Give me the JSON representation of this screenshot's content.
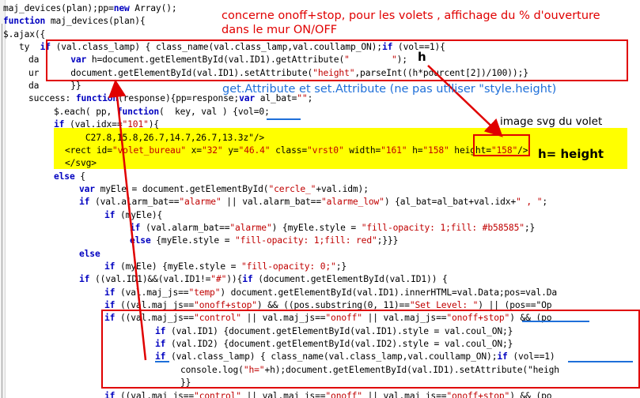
{
  "code_lines": [
    {
      "indent": 4,
      "text": "maj_devices(plan);pp=new Array();"
    },
    {
      "indent": 4,
      "text": "function maj_devices(plan){"
    },
    {
      "indent": 4,
      "text": "$.ajax({"
    },
    {
      "indent": 24,
      "text": "ty  if (val.class_lamp) { class_name(val.class_lamp,val.coullamp_ON);if (vol==1){"
    },
    {
      "indent": 36,
      "text": "da      var h=document.getElementById(val.ID1).getAttribute(\"        \");"
    },
    {
      "indent": 36,
      "text": "ur      document.getElementById(val.ID1).setAttribute(\"height\",parseInt((h*pourcent[2])/100));}"
    },
    {
      "indent": 36,
      "text": "da      }}"
    },
    {
      "indent": 36,
      "text": "success: function(response){pp=response;var al_bat=\"\";"
    },
    {
      "indent": 68,
      "text": "$.each( pp, function(  key, val ) {vol=0;"
    },
    {
      "indent": 68,
      "text": "if (val.idx==\"101\"){"
    },
    {
      "indent": 68,
      "text": "      C27.8,15.8,26.7,14.7,26.7,13.3z\"/>"
    },
    {
      "indent": 82,
      "text": "<rect id=\"volet_bureau\" x=\"32\" y=\"46.4\" class=\"vrst0\" width=\"161\" h=\"158\" height=\"158\"/>"
    },
    {
      "indent": 82,
      "text": "</svg>"
    },
    {
      "indent": 68,
      "text": "else {"
    },
    {
      "indent": 100,
      "text": "var myEle = document.getElementById(\"cercle_\"+val.idm);"
    },
    {
      "indent": 100,
      "text": "if (val.alarm_bat==\"alarme\" || val.alarm_bat==\"alarme_low\") {al_bat=al_bat+val.idx+\" , \";"
    },
    {
      "indent": 132,
      "text": "if (myEle){"
    },
    {
      "indent": 164,
      "text": "if (val.alarm_bat==\"alarme\") {myEle.style = \"fill-opacity: 1;fill: #b58585\";}"
    },
    {
      "indent": 164,
      "text": "else {myEle.style = \"fill-opacity: 1;fill: red\";}}}"
    },
    {
      "indent": 100,
      "text": "else"
    },
    {
      "indent": 132,
      "text": "if (myEle) {myEle.style = \"fill-opacity: 0;\";}"
    },
    {
      "indent": 100,
      "text": "if ((val.ID1)&&(val.ID1!=\"#\")){if (document.getElementById(val.ID1)) {"
    },
    {
      "indent": 132,
      "text": "if (val.maj_js==\"temp\") document.getElementById(val.ID1).innerHTML=val.Data;pos=val.Da"
    },
    {
      "indent": 132,
      "text": "if ((val.maj_js==\"onoff+stop\") && ((pos.substring(0, 11)==\"Set Level: \") || (pos==\"Op"
    },
    {
      "indent": 132,
      "text": "if ((val.maj_js==\"control\" || val.maj_js==\"onoff\" || val.maj_js==\"onoff+stop\") && (po"
    },
    {
      "indent": 196,
      "text": "if (val.ID1) {document.getElementById(val.ID1).style = val.coul_ON;}"
    },
    {
      "indent": 196,
      "text": "if (val.ID2) {document.getElementById(val.ID2).style = val.coul_ON;}"
    },
    {
      "indent": 196,
      "text": "if (val.class_lamp) { class_name(val.class_lamp,val.coullamp_ON);if (vol==1)"
    },
    {
      "indent": 228,
      "text": "console.log(\"h=\"+h);document.getElementById(val.ID1).setAttribute(\"heigh"
    },
    {
      "indent": 228,
      "text": "}}"
    },
    {
      "indent": 132,
      "text": "if ((val.maj_js==\"control\" || val.maj_js==\"onoff\" || val.maj_js==\"onoff+stop\") && (po"
    }
  ],
  "annotations": {
    "title_line1": "concerne onoff+stop, pour les volets , affichage du % d'ouverture",
    "title_line2": "dans le mur ON/OFF",
    "attribute_note": "get.Attribute et set.Attribute (ne pas utiliser \"style.height)",
    "svg_note": "image svg du volet",
    "h_marker": "h",
    "h_equals": "h= height"
  },
  "colors": {
    "annotation_red": "#e00000",
    "annotation_blue": "#1e6fd9",
    "keyword": "#0000c0",
    "string": "#c00000",
    "highlight": "#ffff00"
  }
}
